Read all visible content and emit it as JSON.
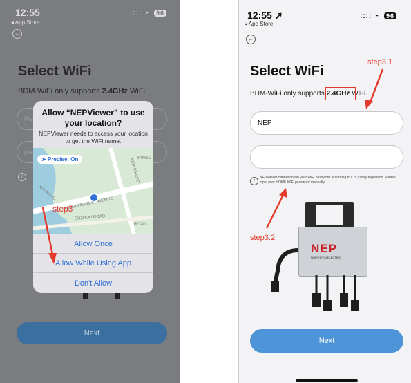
{
  "left": {
    "status": {
      "time": "12:55",
      "back_app": "◂ App Store",
      "signal": "::::",
      "wifi": "◔",
      "battery": "96"
    },
    "title": "Select WiFi",
    "subtitle_pre": "BDM-WiFi only supports ",
    "subtitle_bold": "2.4GHz",
    "subtitle_post": " WiFi.",
    "field1_placeholder": "Plea",
    "field2_placeholder": "plea",
    "dialog": {
      "title_line1": "Allow “NEPViewer” to use",
      "title_line2": "your location?",
      "message": "NEPViewer needs to access your location to get the WiFi name.",
      "precise": "➤ Precise: On",
      "map_labels": [
        "YANGCHENGHU AVENUE",
        "SUZHOU ROAD",
        "KEHUI ROAD",
        "YANGC",
        "JUN ROAD",
        "ROAD"
      ],
      "btn_once": "Allow Once",
      "btn_while": "Allow While Using App",
      "btn_dont": "Don't Allow"
    },
    "annotation": "step3",
    "next": "Next"
  },
  "right": {
    "status": {
      "time": "12:55 ➚",
      "back_app": "◂ App Store",
      "signal": "::::",
      "wifi": "◔",
      "battery": "96"
    },
    "title": "Select WiFi",
    "subtitle_pre": "BDM-WiFi only supports ",
    "subtitle_bold": "2.4GHz",
    "subtitle_post": " WiFi.",
    "ssid_value": "NEP",
    "password_value": "",
    "note": "NEPViewer cannot obtain your WiFi password according to iOS safety regulation. Please input your HOME WiFi password manually.",
    "device_brand": "NEP",
    "device_sub": "NORTHERN ELECTRIC",
    "annotation_31": "step3.1",
    "annotation_32": "step3.2",
    "next": "Next"
  },
  "colors": {
    "accent_blue": "#4d94d8",
    "annotation_red": "#e23b2e",
    "ios_blue": "#2f6fd6"
  }
}
